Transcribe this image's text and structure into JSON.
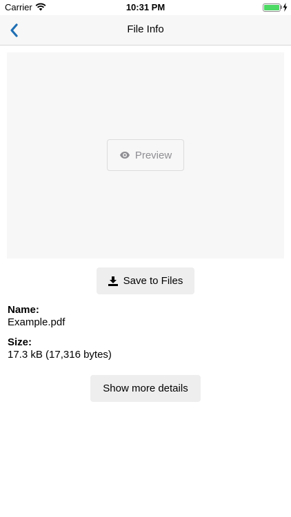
{
  "status_bar": {
    "carrier": "Carrier",
    "time": "10:31 PM",
    "battery_level": 1.0,
    "charging": true,
    "icons": [
      "wifi-icon",
      "battery-icon",
      "charging-bolt-icon"
    ]
  },
  "nav": {
    "title": "File Info",
    "back_icon": "chevron-left-icon",
    "accent_color": "#1f6fb3"
  },
  "preview": {
    "button_label": "Preview",
    "icon": "eye-icon"
  },
  "actions": {
    "save_label": "Save to Files",
    "save_icon": "download-icon",
    "more_label": "Show more details"
  },
  "info": {
    "name_label": "Name:",
    "name_value": "Example.pdf",
    "size_label": "Size:",
    "size_value": "17.3 kB (17,316 bytes)"
  }
}
